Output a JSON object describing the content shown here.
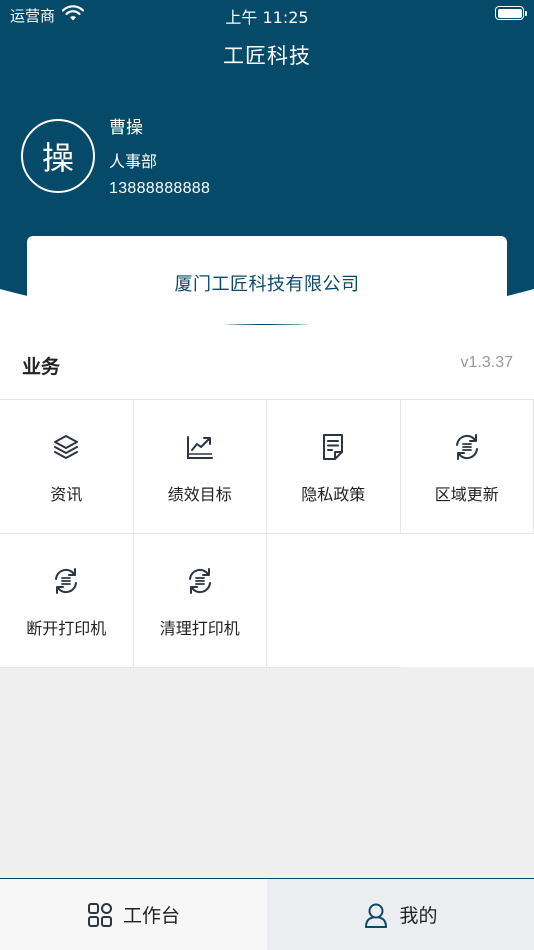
{
  "status_bar": {
    "carrier": "运营商",
    "time": "上午 11:25"
  },
  "nav": {
    "title": "工匠科技"
  },
  "user": {
    "avatar_char": "操",
    "name": "曹操",
    "department": "人事部",
    "phone": "13888888888"
  },
  "company": {
    "name": "厦门工匠科技有限公司"
  },
  "business": {
    "title": "业务",
    "version": "v1.3.37",
    "items": [
      {
        "label": "资讯",
        "icon": "layers-icon"
      },
      {
        "label": "绩效目标",
        "icon": "chart-trend-icon"
      },
      {
        "label": "隐私政策",
        "icon": "document-icon"
      },
      {
        "label": "区域更新",
        "icon": "refresh-icon"
      },
      {
        "label": "断开打印机",
        "icon": "refresh-icon"
      },
      {
        "label": "清理打印机",
        "icon": "refresh-icon"
      }
    ]
  },
  "tabbar": {
    "tabs": [
      {
        "label": "工作台",
        "icon": "grid-icon",
        "active": false
      },
      {
        "label": "我的",
        "icon": "user-icon",
        "active": true
      }
    ]
  },
  "colors": {
    "primary": "#064a6a",
    "background": "#efeff0",
    "accent_text": "#0b4a6b"
  }
}
